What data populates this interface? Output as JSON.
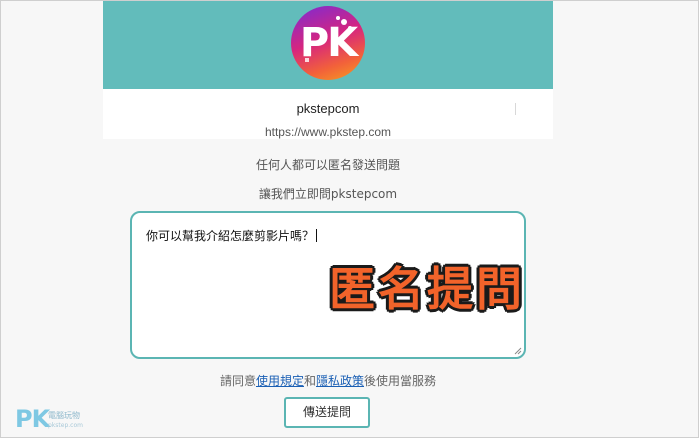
{
  "profile": {
    "avatar_text": "PK",
    "username": "pkstepcom",
    "url": "https://www.pkstep.com"
  },
  "intro": {
    "line1": "任何人都可以匿名發送問題",
    "line2": "讓我們立即問pkstepcom"
  },
  "question": {
    "value": "你可以幫我介紹怎麼剪影片嗎？"
  },
  "overlay": {
    "caption": "匿名提問"
  },
  "terms": {
    "prefix": "請同意",
    "link_terms": "使用規定",
    "and": "和",
    "link_privacy": "隱私政策",
    "suffix": "後使用當服務"
  },
  "actions": {
    "send_label": "傳送提問"
  },
  "watermark": {
    "logo": "PK",
    "text": "電腦玩物",
    "subtext": "pkstep.com"
  },
  "colors": {
    "banner": "#62bcbb",
    "accent": "#5bb5b3",
    "caption": "#f2632a",
    "link": "#1a5fb4"
  }
}
